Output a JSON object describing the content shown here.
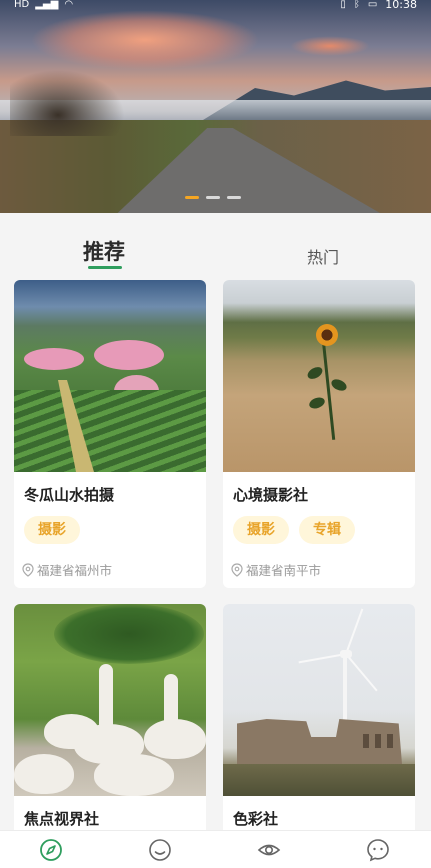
{
  "status_bar": {
    "left_badge": "HD",
    "time": "10:38",
    "icons": [
      "hd-icon",
      "signal-icon",
      "wifi-icon",
      "vibrate-icon",
      "bluetooth-icon",
      "battery-icon"
    ]
  },
  "banner": {
    "slide_count": 3,
    "active_slide": 0
  },
  "tabs": [
    {
      "label": "推荐",
      "active": true
    },
    {
      "label": "热门",
      "active": false
    }
  ],
  "cards": [
    {
      "title": "冬瓜山水拍摄",
      "tags": [
        "摄影"
      ],
      "location": "福建省福州市"
    },
    {
      "title": "心境摄影社",
      "tags": [
        "摄影",
        "专辑"
      ],
      "location": "福建省南平市"
    },
    {
      "title": "焦点视界社",
      "tags": [],
      "location": ""
    },
    {
      "title": "色彩社",
      "tags": [],
      "location": ""
    }
  ],
  "bottom_nav": [
    {
      "icon": "compass-icon",
      "active": true,
      "color": "#2f9e5e"
    },
    {
      "icon": "smiley-icon",
      "active": false
    },
    {
      "icon": "eye-icon",
      "active": false
    },
    {
      "icon": "chat-face-icon",
      "active": false
    }
  ],
  "colors": {
    "accent_green": "#2f9e5e",
    "tag_text": "#e8a42a",
    "tag_bg": "#fff6da",
    "dot_active": "#f5a623"
  }
}
